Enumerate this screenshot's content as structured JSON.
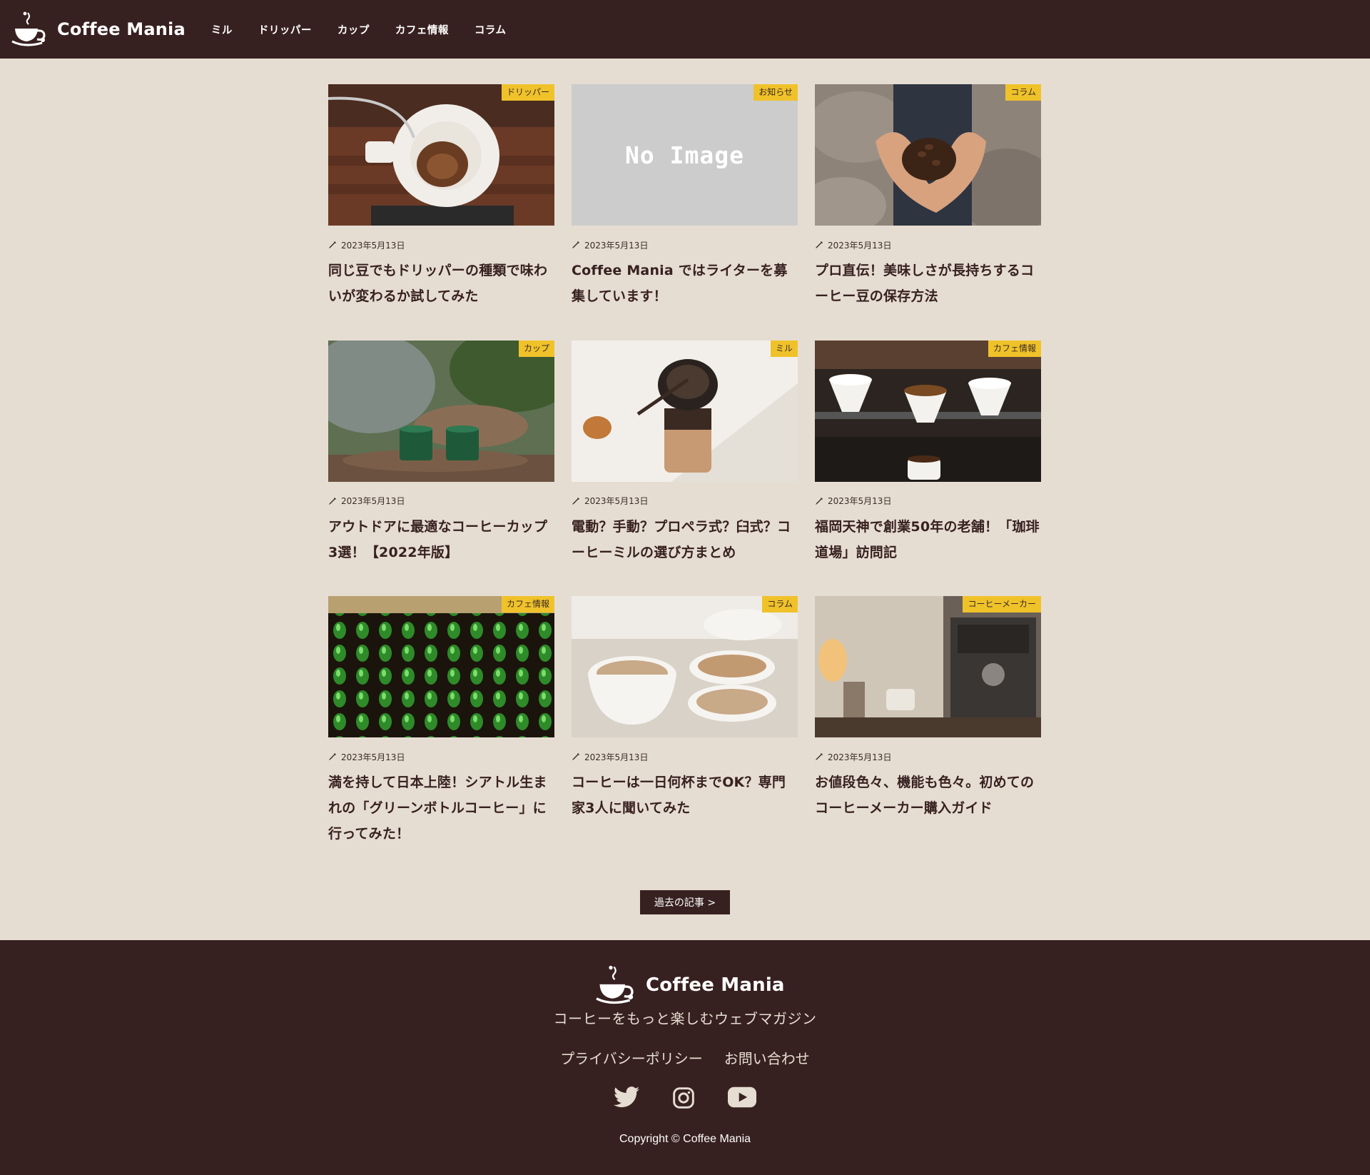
{
  "brand": {
    "name": "Coffee Mania"
  },
  "nav": [
    {
      "label": "ミル"
    },
    {
      "label": "ドリッパー"
    },
    {
      "label": "カップ"
    },
    {
      "label": "カフェ情報"
    },
    {
      "label": "コラム"
    }
  ],
  "posts": [
    {
      "category": "ドリッパー",
      "date": "2023年5月13日",
      "title": "同じ豆でもドリッパーの種類で味わいが変わるか試してみた",
      "image": "dripper"
    },
    {
      "category": "お知らせ",
      "date": "2023年5月13日",
      "title": "Coffee Mania ではライターを募集しています！",
      "image": "none",
      "no_image_text": "No Image"
    },
    {
      "category": "コラム",
      "date": "2023年5月13日",
      "title": "プロ直伝！美味しさが長持ちするコーヒー豆の保存方法",
      "image": "beans"
    },
    {
      "category": "カップ",
      "date": "2023年5月13日",
      "title": "アウトドアに最適なコーヒーカップ3選！【2022年版】",
      "image": "cups-outdoor"
    },
    {
      "category": "ミル",
      "date": "2023年5月13日",
      "title": "電動？手動？プロペラ式？臼式？コーヒーミルの選び方まとめ",
      "image": "mill"
    },
    {
      "category": "カフェ情報",
      "date": "2023年5月13日",
      "title": "福岡天神で創業50年の老舗！「珈琲道場」訪問記",
      "image": "drip-station"
    },
    {
      "category": "カフェ情報",
      "date": "2023年5月13日",
      "title": "満を持して日本上陸！シアトル生まれの「グリーンボトルコーヒー」に行ってみた！",
      "image": "green-bottles"
    },
    {
      "category": "コラム",
      "date": "2023年5月13日",
      "title": "コーヒーは一日何杯までOK？専門家3人に聞いてみた",
      "image": "empty-cups"
    },
    {
      "category": "コーヒーメーカー",
      "date": "2023年5月13日",
      "title": "お値段色々、機能も色々。初めてのコーヒーメーカー購入ガイド",
      "image": "espresso-machine"
    }
  ],
  "more_button": {
    "label": "過去の記事 >"
  },
  "footer": {
    "brand_name": "Coffee Mania",
    "tagline": "コーヒーをもっと楽しむウェブマガジン",
    "links": [
      {
        "label": "プライバシーポリシー"
      },
      {
        "label": "お問い合わせ"
      }
    ],
    "social": [
      {
        "icon": "twitter-icon"
      },
      {
        "icon": "instagram-icon"
      },
      {
        "icon": "youtube-icon"
      }
    ],
    "copyright": "Copyright © Coffee Mania"
  },
  "colors": {
    "header_bg": "#372120",
    "page_bg": "#e6ddd2",
    "badge_bg": "#f0c22a",
    "text": "#372120"
  }
}
